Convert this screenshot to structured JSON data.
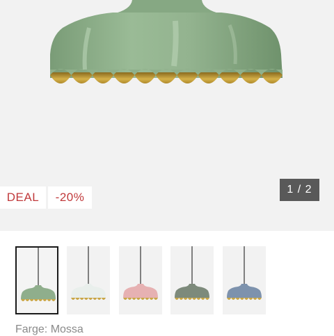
{
  "gallery": {
    "deal_badge": "DEAL",
    "discount_badge": "-20%",
    "counter": "1 / 2",
    "main_image": "green-scalloped-pendant-lamp"
  },
  "colors": {
    "deal_red": "#c0393b",
    "counter_bg": "#595959",
    "gold": "#c9a646"
  },
  "thumbnails": [
    {
      "name": "green",
      "color": "#8fae8c",
      "selected": true
    },
    {
      "name": "white",
      "color": "#e9efec",
      "selected": false
    },
    {
      "name": "pink",
      "color": "#e6b1b2",
      "selected": false
    },
    {
      "name": "grey-green",
      "color": "#7d8a7b",
      "selected": false
    },
    {
      "name": "blue",
      "color": "#7d92ad",
      "selected": false
    }
  ],
  "variant": {
    "label": "Farge: Mossa"
  }
}
